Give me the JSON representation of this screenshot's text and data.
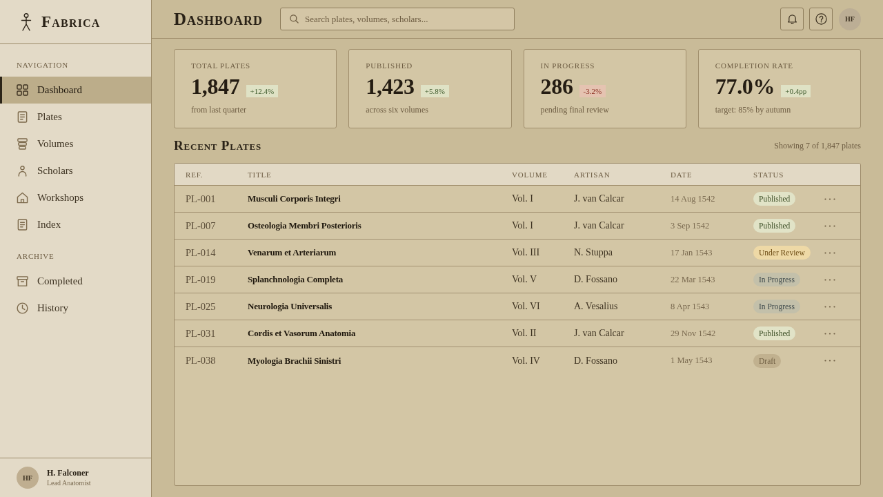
{
  "sidebar": {
    "brand": "Fabrica",
    "sections": [
      {
        "heading": "NAVIGATION",
        "items": [
          {
            "label": "Dashboard",
            "selected": true
          },
          {
            "label": "Plates",
            "selected": false
          },
          {
            "label": "Volumes",
            "selected": false
          },
          {
            "label": "Scholars",
            "selected": false
          },
          {
            "label": "Workshops",
            "selected": false
          },
          {
            "label": "Index",
            "selected": false
          }
        ]
      },
      {
        "heading": "ARCHIVE",
        "items": [
          {
            "label": "Completed",
            "selected": false
          },
          {
            "label": "History",
            "selected": false
          }
        ]
      }
    ],
    "user": {
      "initials": "HF",
      "name": "H. Falconer",
      "role": "Lead Anatomist"
    }
  },
  "header": {
    "title": "Dashboard",
    "search": {
      "placeholder": "Search plates, volumes, scholars..."
    },
    "avatar": "HF"
  },
  "stats": [
    {
      "label": "TOTAL PLATES",
      "value": "1,847",
      "change": {
        "text": "+12.4%",
        "kind": "positive"
      },
      "note": "from last quarter"
    },
    {
      "label": "PUBLISHED",
      "value": "1,423",
      "change": {
        "text": "+5.8%",
        "kind": "positive"
      },
      "note": "across six volumes"
    },
    {
      "label": "IN PROGRESS",
      "value": "286",
      "change": {
        "text": "-3.2%",
        "kind": "negative"
      },
      "note": "pending final review"
    },
    {
      "label": "COMPLETION RATE",
      "value": "77.0%",
      "change": {
        "text": "+0.4pp",
        "kind": "positive"
      },
      "note": "target: 85% by autumn"
    }
  ],
  "recent_plates": {
    "title": "Recent Plates",
    "summary": "Showing 7 of 1,847 plates",
    "columns": [
      "REF.",
      "TITLE",
      "VOLUME",
      "ARTISAN",
      "DATE",
      "STATUS"
    ],
    "rows": [
      {
        "ref": "PL-001",
        "title": "Musculi Corporis Integri",
        "volume": "Vol. I",
        "artisan": "J. van Calcar",
        "date": "14 Aug 1542",
        "status": {
          "label": "Published",
          "kind": "published"
        }
      },
      {
        "ref": "PL-007",
        "title": "Osteologia Membri Posterioris",
        "volume": "Vol. I",
        "artisan": "J. van Calcar",
        "date": "3 Sep 1542",
        "status": {
          "label": "Published",
          "kind": "published"
        }
      },
      {
        "ref": "PL-014",
        "title": "Venarum et Arteriarum",
        "volume": "Vol. III",
        "artisan": "N. Stuppa",
        "date": "17 Jan 1543",
        "status": {
          "label": "Under Review",
          "kind": "review"
        }
      },
      {
        "ref": "PL-019",
        "title": "Splanchnologia Completa",
        "volume": "Vol. V",
        "artisan": "D. Fossano",
        "date": "22 Mar 1543",
        "status": {
          "label": "In Progress",
          "kind": "progress"
        }
      },
      {
        "ref": "PL-025",
        "title": "Neurologia Universalis",
        "volume": "Vol. VI",
        "artisan": "A. Vesalius",
        "date": "8 Apr 1543",
        "status": {
          "label": "In Progress",
          "kind": "progress"
        }
      },
      {
        "ref": "PL-031",
        "title": "Cordis et Vasorum Anatomia",
        "volume": "Vol. II",
        "artisan": "J. van Calcar",
        "date": "29 Nov 1542",
        "status": {
          "label": "Published",
          "kind": "published"
        }
      },
      {
        "ref": "PL-038",
        "title": "Myologia Brachii Sinistri",
        "volume": "Vol. IV",
        "artisan": "D. Fossano",
        "date": "1 May 1543",
        "status": {
          "label": "Draft",
          "kind": "draft"
        }
      }
    ]
  }
}
